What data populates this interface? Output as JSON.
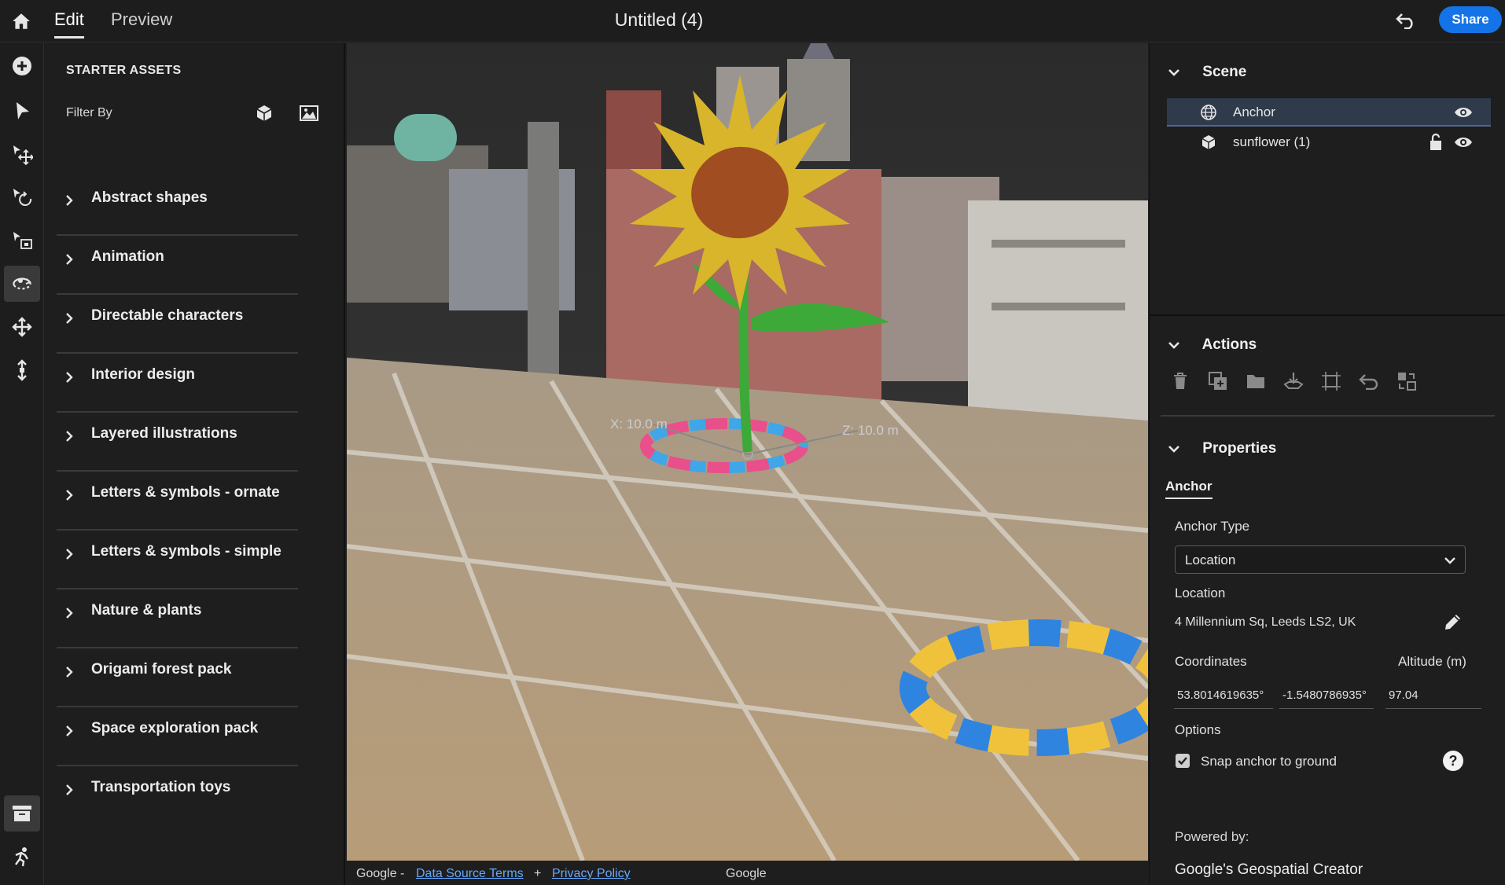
{
  "header": {
    "tabs": [
      {
        "label": "Edit"
      },
      {
        "label": "Preview"
      }
    ],
    "title": "Untitled (4)",
    "share_label": "Share"
  },
  "tools": [
    {
      "icon": "add-icon"
    },
    {
      "icon": "select-arrow-icon"
    },
    {
      "icon": "move-tool-icon"
    },
    {
      "icon": "rotate-tool-icon"
    },
    {
      "icon": "scale-tool-icon"
    },
    {
      "icon": "orbit-tool-icon"
    },
    {
      "icon": "pan-tool-icon"
    },
    {
      "icon": "dolly-tool-icon"
    },
    {
      "icon": "assets-panel-icon"
    },
    {
      "icon": "interactions-icon"
    }
  ],
  "assets": {
    "title": "STARTER ASSETS",
    "filter_label": "Filter By",
    "categories": [
      {
        "label": "Abstract shapes"
      },
      {
        "label": "Animation"
      },
      {
        "label": "Directable characters"
      },
      {
        "label": "Interior design"
      },
      {
        "label": "Layered illustrations"
      },
      {
        "label": "Letters & symbols - ornate"
      },
      {
        "label": "Letters & symbols - simple"
      },
      {
        "label": "Nature & plants"
      },
      {
        "label": "Origami forest pack"
      },
      {
        "label": "Space exploration pack"
      },
      {
        "label": "Transportation toys"
      }
    ]
  },
  "viewport": {
    "gizmo_x_label": "X: 10.0 m",
    "gizmo_z_label": "Z: 10.0 m"
  },
  "footer": {
    "prefix": "Google -",
    "data_source_link": "Data Source Terms",
    "plus": "+",
    "privacy_link": "Privacy Policy",
    "google_label": "Google"
  },
  "scene": {
    "title": "Scene",
    "items": [
      {
        "name": "Anchor",
        "icon": "globe-icon",
        "selected": true
      },
      {
        "name": "sunflower (1)",
        "icon": "cube-icon",
        "selected": false
      }
    ]
  },
  "actions": {
    "title": "Actions",
    "icons": [
      "delete-icon",
      "duplicate-icon",
      "group-folder-icon",
      "drop-to-ground-icon",
      "fit-bounds-icon",
      "reset-icon",
      "replace-icon"
    ]
  },
  "properties": {
    "title": "Properties",
    "subtab": "Anchor",
    "anchor_type_label": "Anchor Type",
    "anchor_type_value": "Location",
    "location_label": "Location",
    "location_value": "4 Millennium Sq, Leeds LS2, UK",
    "coordinates_label": "Coordinates",
    "altitude_label": "Altitude (m)",
    "latitude": "53.8014619635°",
    "longitude": "-1.5480786935°",
    "altitude": "97.04",
    "options_label": "Options",
    "snap_label": "Snap anchor to ground",
    "snap_checked": true,
    "powered_label": "Powered by:",
    "powered_value": "Google's Geospatial Creator"
  },
  "colors": {
    "accent": "#1473e6",
    "selected_row": "#2f3a4b",
    "link": "#64a8ff"
  }
}
